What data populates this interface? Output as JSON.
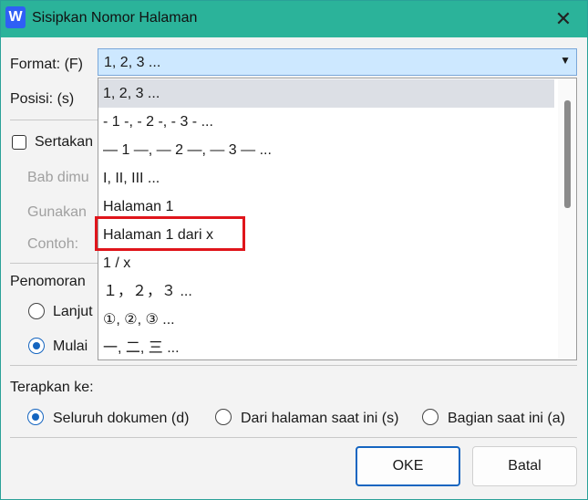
{
  "window": {
    "title": "Sisipkan Nomor Halaman",
    "app_icon_letter": "W",
    "close_glyph": "✕"
  },
  "format": {
    "label": "Format: (F)",
    "selected": "1, 2, 3 ...",
    "arrow": "▼"
  },
  "dropdown": {
    "options": [
      "1, 2, 3 ...",
      "- 1 -, - 2 -, - 3 - ...",
      "— 1 —, — 2 —, — 3 — ...",
      "I, II, III ...",
      "Halaman 1",
      "Halaman 1 dari x",
      "1 / x",
      "１，２，３ ...",
      "①, ②, ③ ...",
      "一, 二, 三 ..."
    ],
    "selected_index": 0,
    "highlighted_option": "Halaman 1 dari x"
  },
  "position": {
    "label": "Posisi: (s)"
  },
  "chapter": {
    "checkbox_label": "Sertakan",
    "checked": false,
    "starts_label": "Bab dimu",
    "use_label": "Gunakan",
    "example_label": "Contoh:"
  },
  "numbering": {
    "label": "Penomoran",
    "continue_label": "Lanjut",
    "start_label": "Mulai",
    "selected": "start"
  },
  "apply": {
    "label": "Terapkan ke:",
    "options": [
      "Seluruh dokumen (d)",
      "Dari halaman saat ini (s)",
      "Bagian saat ini (a)"
    ],
    "selected_index": 0
  },
  "buttons": {
    "ok": "OKE",
    "cancel": "Batal"
  },
  "colors": {
    "titlebar": "#2bb39a",
    "accent": "#1565c0",
    "highlight_border": "#e0151b"
  }
}
